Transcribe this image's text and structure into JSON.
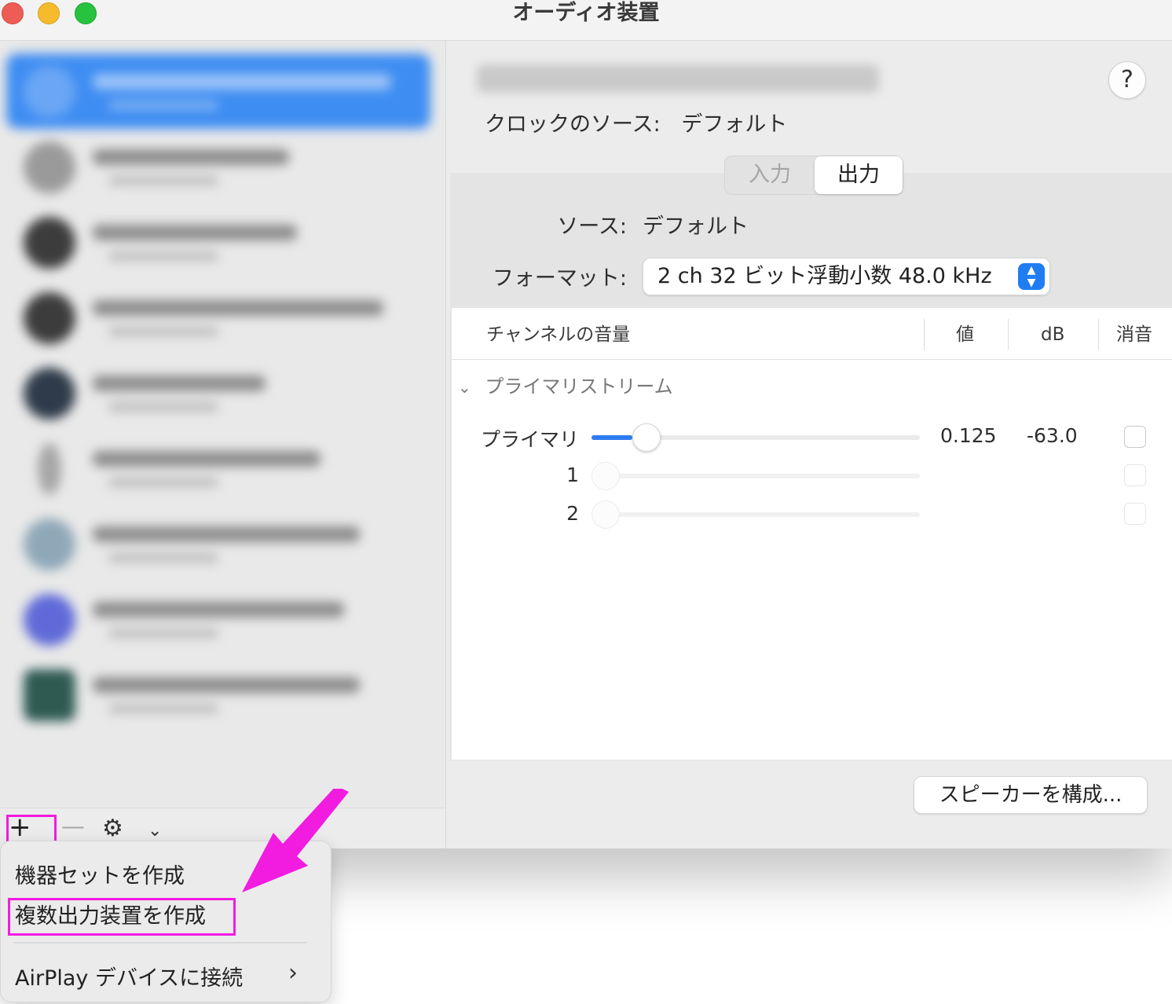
{
  "window": {
    "title": "オーディオ装置"
  },
  "sidebar": {
    "toolbar": {
      "add_label": "+",
      "remove_label": "—",
      "gear_icon": "gear-icon",
      "chevron_icon": "chevron-down-icon"
    }
  },
  "main": {
    "help_label": "?",
    "clock": {
      "label": "クロックのソース:",
      "value": "デフォルト"
    },
    "tabs": [
      {
        "label": "入力",
        "selected": false
      },
      {
        "label": "出力",
        "selected": true
      }
    ],
    "source": {
      "label": "ソース:",
      "value": "デフォルト"
    },
    "format": {
      "label": "フォーマット:",
      "value": "2 ch 32 ビット浮動小数 48.0 kHz"
    },
    "table": {
      "headers": {
        "name": "チャンネルの音量",
        "value": "値",
        "db": "dB",
        "mute": "消音"
      },
      "group": "プライマリストリーム",
      "rows": [
        {
          "label": "プライマリ",
          "value": "0.125",
          "db": "-63.0",
          "level": 0.125
        },
        {
          "label": "1",
          "value": "",
          "db": "",
          "level": 0
        },
        {
          "label": "2",
          "value": "",
          "db": "",
          "level": 0
        }
      ]
    },
    "speaker_button": "スピーカーを構成..."
  },
  "menu": {
    "items": [
      {
        "label": "機器セットを作成"
      },
      {
        "label": "複数出力装置を作成"
      },
      {
        "label": "AirPlay デバイスに接続"
      }
    ]
  },
  "colors": {
    "accent": "#1f7df1",
    "annotation": "#f21be0"
  }
}
